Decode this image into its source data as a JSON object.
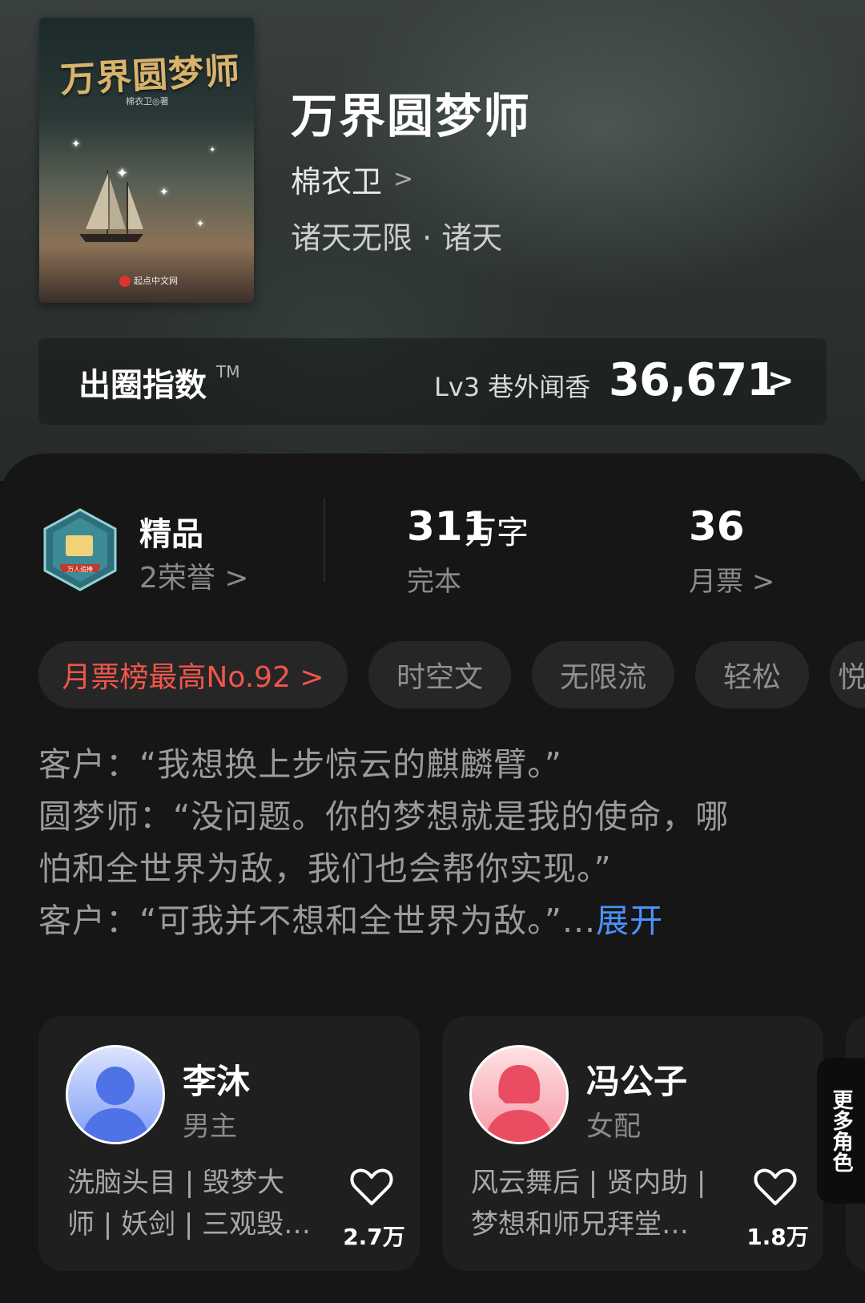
{
  "book": {
    "cover_title": "万界圆梦师",
    "cover_author": "棉衣卫◎著",
    "cover_publisher": "起点中文网",
    "title": "万界圆梦师",
    "author": "棉衣卫",
    "genre": "诸天无限 · 诸天"
  },
  "index": {
    "label": "出圈指数",
    "tm": "TM",
    "level": "Lv3 巷外闻香",
    "value": "36,671"
  },
  "stats": {
    "quality_title": "精品",
    "quality_sub": "2荣誉",
    "badge_text": "万人追捧",
    "word_count": "311",
    "word_unit": "万字",
    "status": "完本",
    "monthly_votes": "36",
    "monthly_votes_label": "月票"
  },
  "chips": [
    {
      "label": "月票榜最高No.92 >"
    },
    {
      "label": "时空文"
    },
    {
      "label": "无限流"
    },
    {
      "label": "轻松"
    },
    {
      "label": "悦"
    }
  ],
  "description": {
    "lines": [
      "客户：“我想换上步惊云的麒麟臂。”",
      "圆梦师：“没问题。你的梦想就是我的使命，哪",
      "怕和全世界为敌，我们也会帮你实现。”",
      "客户：“可我并不想和全世界为敌。”..."
    ],
    "expand_label": "展开"
  },
  "roles": [
    {
      "name": "李沐",
      "type": "男主",
      "tags_line1": "洗脑头目 | 毁梦大",
      "tags_line2": "师 | 妖剑 | 三观毁…",
      "likes": "2.7万",
      "avatar_color": "#6f8ff0"
    },
    {
      "name": "冯公子",
      "type": "女配",
      "tags_line1": "风云舞后 | 贤内助 |",
      "tags_line2": "梦想和师兄拜堂…",
      "likes": "1.8万",
      "avatar_color": "#f06a7a"
    }
  ],
  "more_roles_label": "更多角色",
  "colors": {
    "accent_red": "#f0564a",
    "link_blue": "#4a90ff"
  }
}
